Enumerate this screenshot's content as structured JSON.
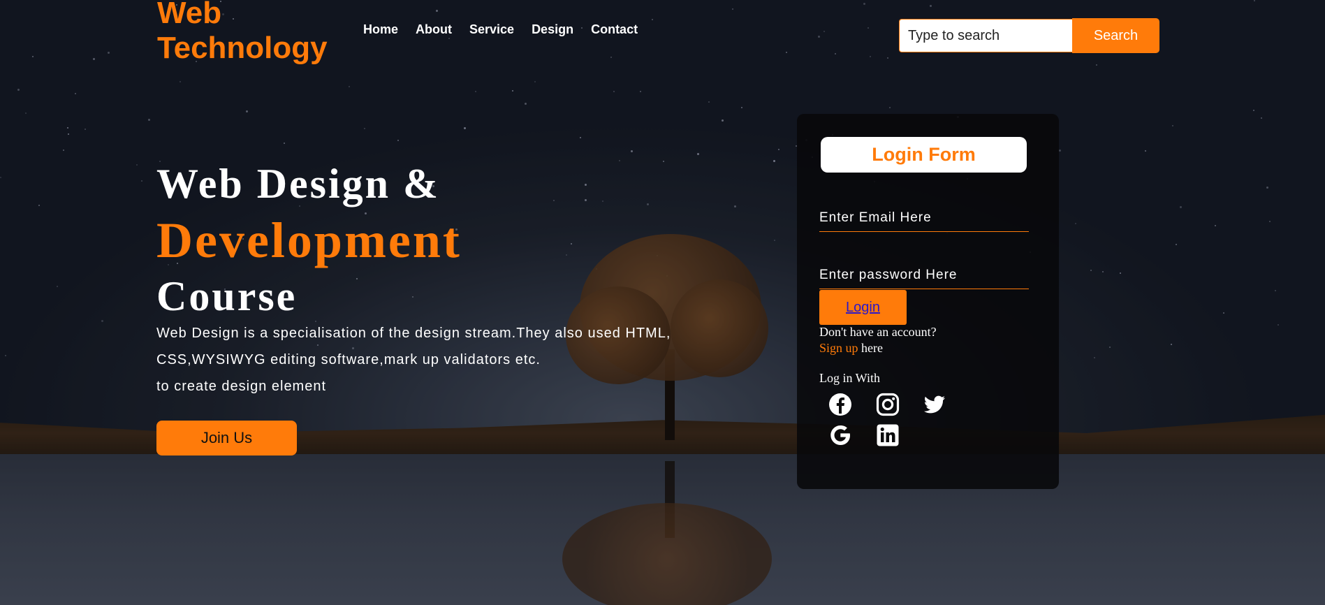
{
  "header": {
    "logo_line1": "Web",
    "logo_line2": "Technology",
    "nav": [
      "Home",
      "About",
      "Service",
      "Design",
      "Contact"
    ],
    "search_placeholder": "Type to search",
    "search_button": "Search"
  },
  "hero": {
    "title_line1": "Web Design &",
    "title_line2": "Development",
    "title_line3": "Course",
    "text_lines": [
      "Web Design is a specialisation of the design stream.They also used HTML,",
      "CSS,WYSIWYG editing software,mark up validators etc.",
      "to create design element"
    ],
    "join_button": "Join Us"
  },
  "login": {
    "title": "Login Form",
    "email_placeholder": "Enter Email Here",
    "password_placeholder": "Enter password Here",
    "login_button": "Login",
    "no_account": "Don't have an account?",
    "signup_link": "Sign up",
    "signup_suffix": " here",
    "login_with": "Log in With",
    "social_icons": [
      "facebook-icon",
      "instagram-icon",
      "twitter-icon",
      "google-icon",
      "linkedin-icon"
    ]
  },
  "colors": {
    "accent": "#ff7b0a",
    "card_bg": "#08080a",
    "text": "#ffffff"
  }
}
